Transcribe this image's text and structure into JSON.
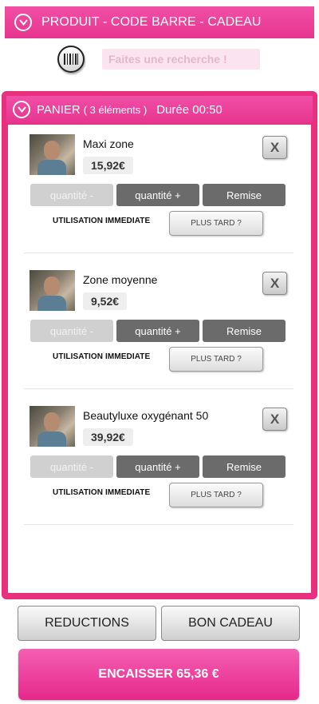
{
  "top_bar": {
    "title": "PRODUIT - CODE BARRE - CADEAU",
    "color": "#e7358f"
  },
  "search": {
    "placeholder": "Faites une recherche !",
    "value": ""
  },
  "cart": {
    "label": "PANIER",
    "count_text": "( 3 éléments )",
    "duration_text": "Durée 00:50",
    "accent_color": "#e8307f",
    "items": [
      {
        "name": "Maxi zone",
        "price": "15,92€",
        "remove_label": "X",
        "qty_minus_label": "quantité -",
        "qty_plus_label": "quantité +",
        "discount_label": "Remise",
        "usage_label": "UTILISATION IMMEDIATE",
        "later_label": "PLUS TARD ?"
      },
      {
        "name": "Zone moyenne",
        "price": "9,52€",
        "remove_label": "X",
        "qty_minus_label": "quantité -",
        "qty_plus_label": "quantité +",
        "discount_label": "Remise",
        "usage_label": "UTILISATION IMMEDIATE",
        "later_label": "PLUS TARD ?"
      },
      {
        "name": "Beautyluxe oxygénant 50",
        "price": "39,92€",
        "remove_label": "X",
        "qty_minus_label": "quantité -",
        "qty_plus_label": "quantité +",
        "discount_label": "Remise",
        "usage_label": "UTILISATION IMMEDIATE",
        "later_label": "PLUS TARD ?"
      }
    ]
  },
  "footer": {
    "reductions_label": "REDUCTIONS",
    "gift_card_label": "BON CADEAU",
    "checkout_label": "ENCAISSER 65,36 €"
  }
}
